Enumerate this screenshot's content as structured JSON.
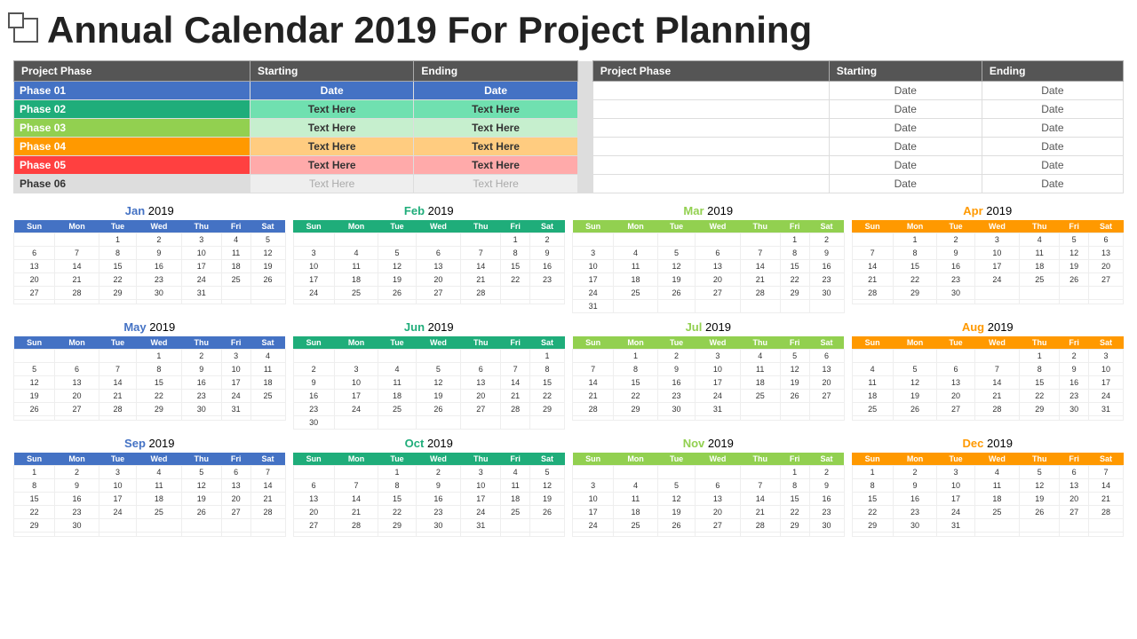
{
  "title": "Annual Calendar 2019 For Project Planning",
  "phases": {
    "headers_left": [
      "Project Phase",
      "Starting",
      "Ending"
    ],
    "headers_right": [
      "Project Phase",
      "Starting",
      "Ending"
    ],
    "rows": [
      {
        "id": "phase01",
        "label": "Phase 01",
        "start": "Date",
        "end": "Date",
        "rstart": "Date",
        "rend": "Date"
      },
      {
        "id": "phase02",
        "label": "Phase 02",
        "start": "Text Here",
        "end": "Text Here",
        "rstart": "Date",
        "rend": "Date"
      },
      {
        "id": "phase03",
        "label": "Phase 03",
        "start": "Text Here",
        "end": "Text Here",
        "rstart": "Date",
        "rend": "Date"
      },
      {
        "id": "phase04",
        "label": "Phase 04",
        "start": "Text Here",
        "end": "Text Here",
        "rstart": "Date",
        "rend": "Date"
      },
      {
        "id": "phase05",
        "label": "Phase 05",
        "start": "Text Here",
        "end": "Text Here",
        "rstart": "Date",
        "rend": "Date"
      },
      {
        "id": "phase06",
        "label": "Phase 06",
        "start": "Text Here",
        "end": "Text Here",
        "rstart": "Date",
        "rend": "Date"
      }
    ]
  },
  "months": [
    {
      "name": "Jan",
      "year": "2019",
      "color_class": "jan-color",
      "header_class": "cal-header-jan",
      "days": [
        "Sun",
        "Mon",
        "Tue",
        "Wed",
        "Thu",
        "Fri",
        "Sat"
      ],
      "weeks": [
        [
          "",
          "",
          "1",
          "2",
          "3",
          "4",
          "5"
        ],
        [
          "6",
          "7",
          "8",
          "9",
          "10",
          "11",
          "12"
        ],
        [
          "13",
          "14",
          "15",
          "16",
          "17",
          "18",
          "19"
        ],
        [
          "20",
          "21",
          "22",
          "23",
          "24",
          "25",
          "26"
        ],
        [
          "27",
          "28",
          "29",
          "30",
          "31",
          "",
          ""
        ],
        [
          "",
          "",
          "",
          "",
          "",
          "",
          ""
        ]
      ]
    },
    {
      "name": "Feb",
      "year": "2019",
      "color_class": "feb-color",
      "header_class": "cal-header-feb",
      "days": [
        "Sun",
        "Mon",
        "Tue",
        "Wed",
        "Thu",
        "Fri",
        "Sat"
      ],
      "weeks": [
        [
          "",
          "",
          "",
          "",
          "",
          "1",
          "2"
        ],
        [
          "3",
          "4",
          "5",
          "6",
          "7",
          "8",
          "9"
        ],
        [
          "10",
          "11",
          "12",
          "13",
          "14",
          "15",
          "16"
        ],
        [
          "17",
          "18",
          "19",
          "20",
          "21",
          "22",
          "23"
        ],
        [
          "24",
          "25",
          "26",
          "27",
          "28",
          "",
          ""
        ],
        [
          "",
          "",
          "",
          "",
          "",
          "",
          ""
        ]
      ]
    },
    {
      "name": "Mar",
      "year": "2019",
      "color_class": "mar-color",
      "header_class": "cal-header-mar",
      "days": [
        "Sun",
        "Mon",
        "Tue",
        "Wed",
        "Thu",
        "Fri",
        "Sat"
      ],
      "weeks": [
        [
          "",
          "",
          "",
          "",
          "",
          "1",
          "2"
        ],
        [
          "3",
          "4",
          "5",
          "6",
          "7",
          "8",
          "9"
        ],
        [
          "10",
          "11",
          "12",
          "13",
          "14",
          "15",
          "16"
        ],
        [
          "17",
          "18",
          "19",
          "20",
          "21",
          "22",
          "23"
        ],
        [
          "24",
          "25",
          "26",
          "27",
          "28",
          "29",
          "30"
        ],
        [
          "31",
          "",
          "",
          "",
          "",
          "",
          ""
        ]
      ]
    },
    {
      "name": "Apr",
      "year": "2019",
      "color_class": "apr-color",
      "header_class": "cal-header-apr",
      "days": [
        "Sun",
        "Mon",
        "Tue",
        "Wed",
        "Thu",
        "Fri",
        "Sat"
      ],
      "weeks": [
        [
          "",
          "1",
          "2",
          "3",
          "4",
          "5",
          "6"
        ],
        [
          "7",
          "8",
          "9",
          "10",
          "11",
          "12",
          "13"
        ],
        [
          "14",
          "15",
          "16",
          "17",
          "18",
          "19",
          "20"
        ],
        [
          "21",
          "22",
          "23",
          "24",
          "25",
          "26",
          "27"
        ],
        [
          "28",
          "29",
          "30",
          "",
          "",
          "",
          ""
        ],
        [
          "",
          "",
          "",
          "",
          "",
          "",
          ""
        ]
      ]
    },
    {
      "name": "May",
      "year": "2019",
      "color_class": "may-color",
      "header_class": "cal-header-may",
      "days": [
        "Sun",
        "Mon",
        "Tue",
        "Wed",
        "Thu",
        "Fri",
        "Sat"
      ],
      "weeks": [
        [
          "",
          "",
          "",
          "1",
          "2",
          "3",
          "4"
        ],
        [
          "5",
          "6",
          "7",
          "8",
          "9",
          "10",
          "11"
        ],
        [
          "12",
          "13",
          "14",
          "15",
          "16",
          "17",
          "18"
        ],
        [
          "19",
          "20",
          "21",
          "22",
          "23",
          "24",
          "25"
        ],
        [
          "26",
          "27",
          "28",
          "29",
          "30",
          "31",
          ""
        ],
        [
          "",
          "",
          "",
          "",
          "",
          "",
          ""
        ]
      ]
    },
    {
      "name": "Jun",
      "year": "2019",
      "color_class": "jun-color",
      "header_class": "cal-header-jun",
      "days": [
        "Sun",
        "Mon",
        "Tue",
        "Wed",
        "Thu",
        "Fri",
        "Sat"
      ],
      "weeks": [
        [
          "",
          "",
          "",
          "",
          "",
          "",
          "1"
        ],
        [
          "2",
          "3",
          "4",
          "5",
          "6",
          "7",
          "8"
        ],
        [
          "9",
          "10",
          "11",
          "12",
          "13",
          "14",
          "15"
        ],
        [
          "16",
          "17",
          "18",
          "19",
          "20",
          "21",
          "22"
        ],
        [
          "23",
          "24",
          "25",
          "26",
          "27",
          "28",
          "29"
        ],
        [
          "30",
          "",
          "",
          "",
          "",
          "",
          ""
        ]
      ]
    },
    {
      "name": "Jul",
      "year": "2019",
      "color_class": "jul-color",
      "header_class": "cal-header-jul",
      "days": [
        "Sun",
        "Mon",
        "Tue",
        "Wed",
        "Thu",
        "Fri",
        "Sat"
      ],
      "weeks": [
        [
          "",
          "1",
          "2",
          "3",
          "4",
          "5",
          "6"
        ],
        [
          "7",
          "8",
          "9",
          "10",
          "11",
          "12",
          "13"
        ],
        [
          "14",
          "15",
          "16",
          "17",
          "18",
          "19",
          "20"
        ],
        [
          "21",
          "22",
          "23",
          "24",
          "25",
          "26",
          "27"
        ],
        [
          "28",
          "29",
          "30",
          "31",
          "",
          "",
          ""
        ],
        [
          "",
          "",
          "",
          "",
          "",
          "",
          ""
        ]
      ]
    },
    {
      "name": "Aug",
      "year": "2019",
      "color_class": "aug-color",
      "header_class": "cal-header-aug",
      "days": [
        "Sun",
        "Mon",
        "Tue",
        "Wed",
        "Thu",
        "Fri",
        "Sat"
      ],
      "weeks": [
        [
          "",
          "",
          "",
          "",
          "1",
          "2",
          "3"
        ],
        [
          "4",
          "5",
          "6",
          "7",
          "8",
          "9",
          "10"
        ],
        [
          "11",
          "12",
          "13",
          "14",
          "15",
          "16",
          "17"
        ],
        [
          "18",
          "19",
          "20",
          "21",
          "22",
          "23",
          "24"
        ],
        [
          "25",
          "26",
          "27",
          "28",
          "29",
          "30",
          "31"
        ],
        [
          "",
          "",
          "",
          "",
          "",
          "",
          ""
        ]
      ]
    },
    {
      "name": "Sep",
      "year": "2019",
      "color_class": "sep-color",
      "header_class": "cal-header-sep",
      "days": [
        "Sun",
        "Mon",
        "Tue",
        "Wed",
        "Thu",
        "Fri",
        "Sat"
      ],
      "weeks": [
        [
          "1",
          "2",
          "3",
          "4",
          "5",
          "6",
          "7"
        ],
        [
          "8",
          "9",
          "10",
          "11",
          "12",
          "13",
          "14"
        ],
        [
          "15",
          "16",
          "17",
          "18",
          "19",
          "20",
          "21"
        ],
        [
          "22",
          "23",
          "24",
          "25",
          "26",
          "27",
          "28"
        ],
        [
          "29",
          "30",
          "",
          "",
          "",
          "",
          ""
        ],
        [
          "",
          "",
          "",
          "",
          "",
          "",
          ""
        ]
      ]
    },
    {
      "name": "Oct",
      "year": "2019",
      "color_class": "oct-color",
      "header_class": "cal-header-oct",
      "days": [
        "Sun",
        "Mon",
        "Tue",
        "Wed",
        "Thu",
        "Fri",
        "Sat"
      ],
      "weeks": [
        [
          "",
          "",
          "1",
          "2",
          "3",
          "4",
          "5"
        ],
        [
          "6",
          "7",
          "8",
          "9",
          "10",
          "11",
          "12"
        ],
        [
          "13",
          "14",
          "15",
          "16",
          "17",
          "18",
          "19"
        ],
        [
          "20",
          "21",
          "22",
          "23",
          "24",
          "25",
          "26"
        ],
        [
          "27",
          "28",
          "29",
          "30",
          "31",
          "",
          ""
        ],
        [
          "",
          "",
          "",
          "",
          "",
          "",
          ""
        ]
      ]
    },
    {
      "name": "Nov",
      "year": "2019",
      "color_class": "nov-color",
      "header_class": "cal-header-nov",
      "days": [
        "Sun",
        "Mon",
        "Tue",
        "Wed",
        "Thu",
        "Fri",
        "Sat"
      ],
      "weeks": [
        [
          "",
          "",
          "",
          "",
          "",
          "1",
          "2"
        ],
        [
          "3",
          "4",
          "5",
          "6",
          "7",
          "8",
          "9"
        ],
        [
          "10",
          "11",
          "12",
          "13",
          "14",
          "15",
          "16"
        ],
        [
          "17",
          "18",
          "19",
          "20",
          "21",
          "22",
          "23"
        ],
        [
          "24",
          "25",
          "26",
          "27",
          "28",
          "29",
          "30"
        ],
        [
          "",
          "",
          "",
          "",
          "",
          "",
          ""
        ]
      ]
    },
    {
      "name": "Dec",
      "year": "2019",
      "color_class": "dec-color",
      "header_class": "cal-header-dec",
      "days": [
        "Sun",
        "Mon",
        "Tue",
        "Wed",
        "Thu",
        "Fri",
        "Sat"
      ],
      "weeks": [
        [
          "1",
          "2",
          "3",
          "4",
          "5",
          "6",
          "7"
        ],
        [
          "8",
          "9",
          "10",
          "11",
          "12",
          "13",
          "14"
        ],
        [
          "15",
          "16",
          "17",
          "18",
          "19",
          "20",
          "21"
        ],
        [
          "22",
          "23",
          "24",
          "25",
          "26",
          "27",
          "28"
        ],
        [
          "29",
          "30",
          "31",
          "",
          "",
          "",
          ""
        ],
        [
          "",
          "",
          "",
          "",
          "",
          "",
          ""
        ]
      ]
    }
  ]
}
